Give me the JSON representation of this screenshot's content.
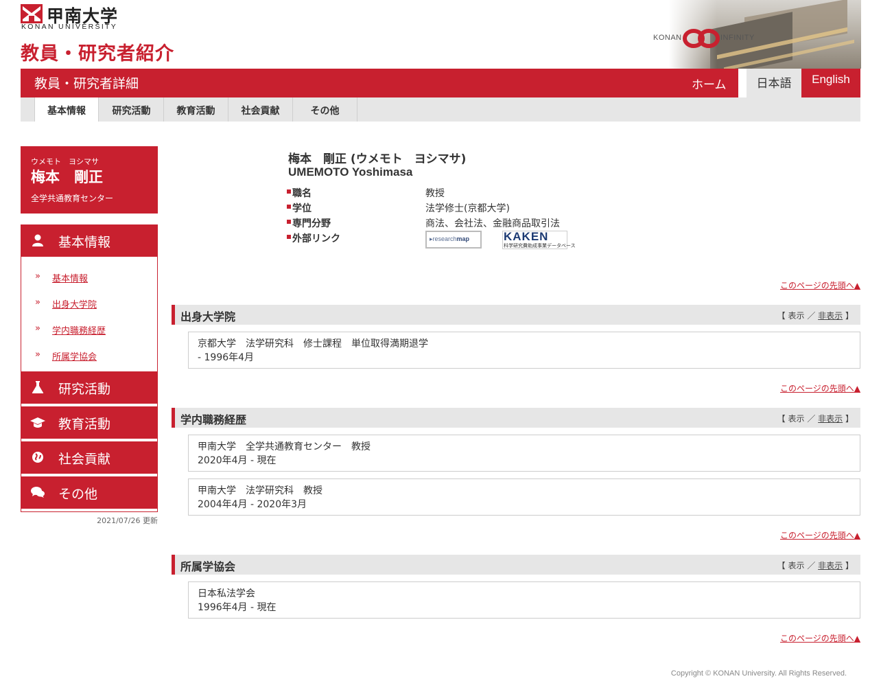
{
  "header": {
    "logo_jp": "甲南大学",
    "logo_en": "KONAN UNIVERSITY",
    "site_title": "教員・研究者紹介",
    "infinity_left": "KONAN",
    "infinity_right": "INFINITY"
  },
  "redbar": {
    "title": "教員・研究者詳細",
    "home": "ホーム",
    "lang_ja": "日本語",
    "lang_en": "English"
  },
  "tabs": [
    "基本情報",
    "研究活動",
    "教育活動",
    "社会貢献",
    "その他"
  ],
  "profile": {
    "kana": "ウメモト　ヨシマサ",
    "name": "梅本　剛正",
    "dept": "全学共通教育センター"
  },
  "sidenav": {
    "sections": [
      "基本情報",
      "研究活動",
      "教育活動",
      "社会貢献",
      "その他"
    ],
    "subitems": [
      "基本情報",
      "出身大学院",
      "学内職務経歴",
      "所属学協会"
    ],
    "chevron": "»"
  },
  "updated": "2021/07/26 更新",
  "person": {
    "name_full": "梅本　剛正 (ウメモト　ヨシマサ)",
    "roman": "UMEMOTO Yoshimasa",
    "fields": [
      {
        "label": "職名",
        "value": "教授"
      },
      {
        "label": "学位",
        "value": "法学修士(京都大学)"
      },
      {
        "label": "専門分野",
        "value": "商法、会社法、金融商品取引法"
      },
      {
        "label": "外部リンク",
        "value": ""
      }
    ],
    "links": {
      "researchmap_prefix": "▸research",
      "researchmap_bold": "map",
      "kaken_title": "KAKEN",
      "kaken_sub": "科学研究費助成事業データベース"
    }
  },
  "to_top": "このページの先頭へ▲",
  "toggle": {
    "open": "【 ",
    "show": "表示",
    "sep": " ／ ",
    "hide": "非表示",
    "close": " 】"
  },
  "sections": [
    {
      "title": "出身大学院",
      "items": [
        {
          "line1": "京都大学　法学研究科　修士課程　単位取得満期退学",
          "line2": "- 1996年4月"
        }
      ]
    },
    {
      "title": "学内職務経歴",
      "items": [
        {
          "line1": "甲南大学　全学共通教育センター　教授",
          "line2": "2020年4月 - 現在"
        },
        {
          "line1": "甲南大学　法学研究科　教授",
          "line2": "2004年4月 - 2020年3月"
        }
      ]
    },
    {
      "title": "所属学協会",
      "items": [
        {
          "line1": "日本私法学会",
          "line2": "1996年4月 - 現在"
        }
      ]
    }
  ],
  "copyright": "Copyright © KONAN University. All Rights Reserved.",
  "colors": {
    "brand": "#c8202f",
    "panel": "#e6e6e6"
  }
}
